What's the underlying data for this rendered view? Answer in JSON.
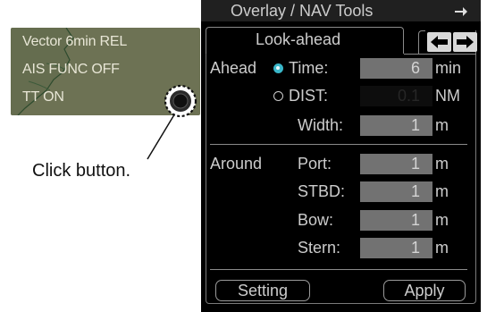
{
  "inset": {
    "vector_text": "Vector 6min REL",
    "ais_text": "AIS FUNC OFF",
    "tt_text": "TT ON",
    "callout": "Click button."
  },
  "panel": {
    "title": "Overlay / NAV Tools",
    "tab_label": "Look-ahead",
    "ahead_label": "Ahead",
    "ahead_rows": [
      {
        "label": "Time:",
        "value": "6",
        "unit": "min",
        "selected": true
      },
      {
        "label": "DIST:",
        "value": "0.1",
        "unit": "NM",
        "selected": false
      },
      {
        "label": "Width:",
        "value": "1",
        "unit": "m"
      }
    ],
    "around_label": "Around",
    "around_rows": [
      {
        "label": "Port:",
        "value": "1",
        "unit": "m"
      },
      {
        "label": "STBD:",
        "value": "1",
        "unit": "m"
      },
      {
        "label": "Bow:",
        "value": "1",
        "unit": "m"
      },
      {
        "label": "Stern:",
        "value": "1",
        "unit": "m"
      }
    ],
    "setting_button": "Setting",
    "apply_button": "Apply"
  },
  "colors": {
    "panel_bg": "#000000",
    "field_bg": "#727272",
    "radio_selected": "#3ab7c9",
    "inset_bg": "#6d7254"
  },
  "icons": {
    "title_arrow": "arrow-right-icon",
    "prev_tab": "arrow-left-icon",
    "next_tab": "arrow-right-icon",
    "dial": "dial-button-icon"
  }
}
